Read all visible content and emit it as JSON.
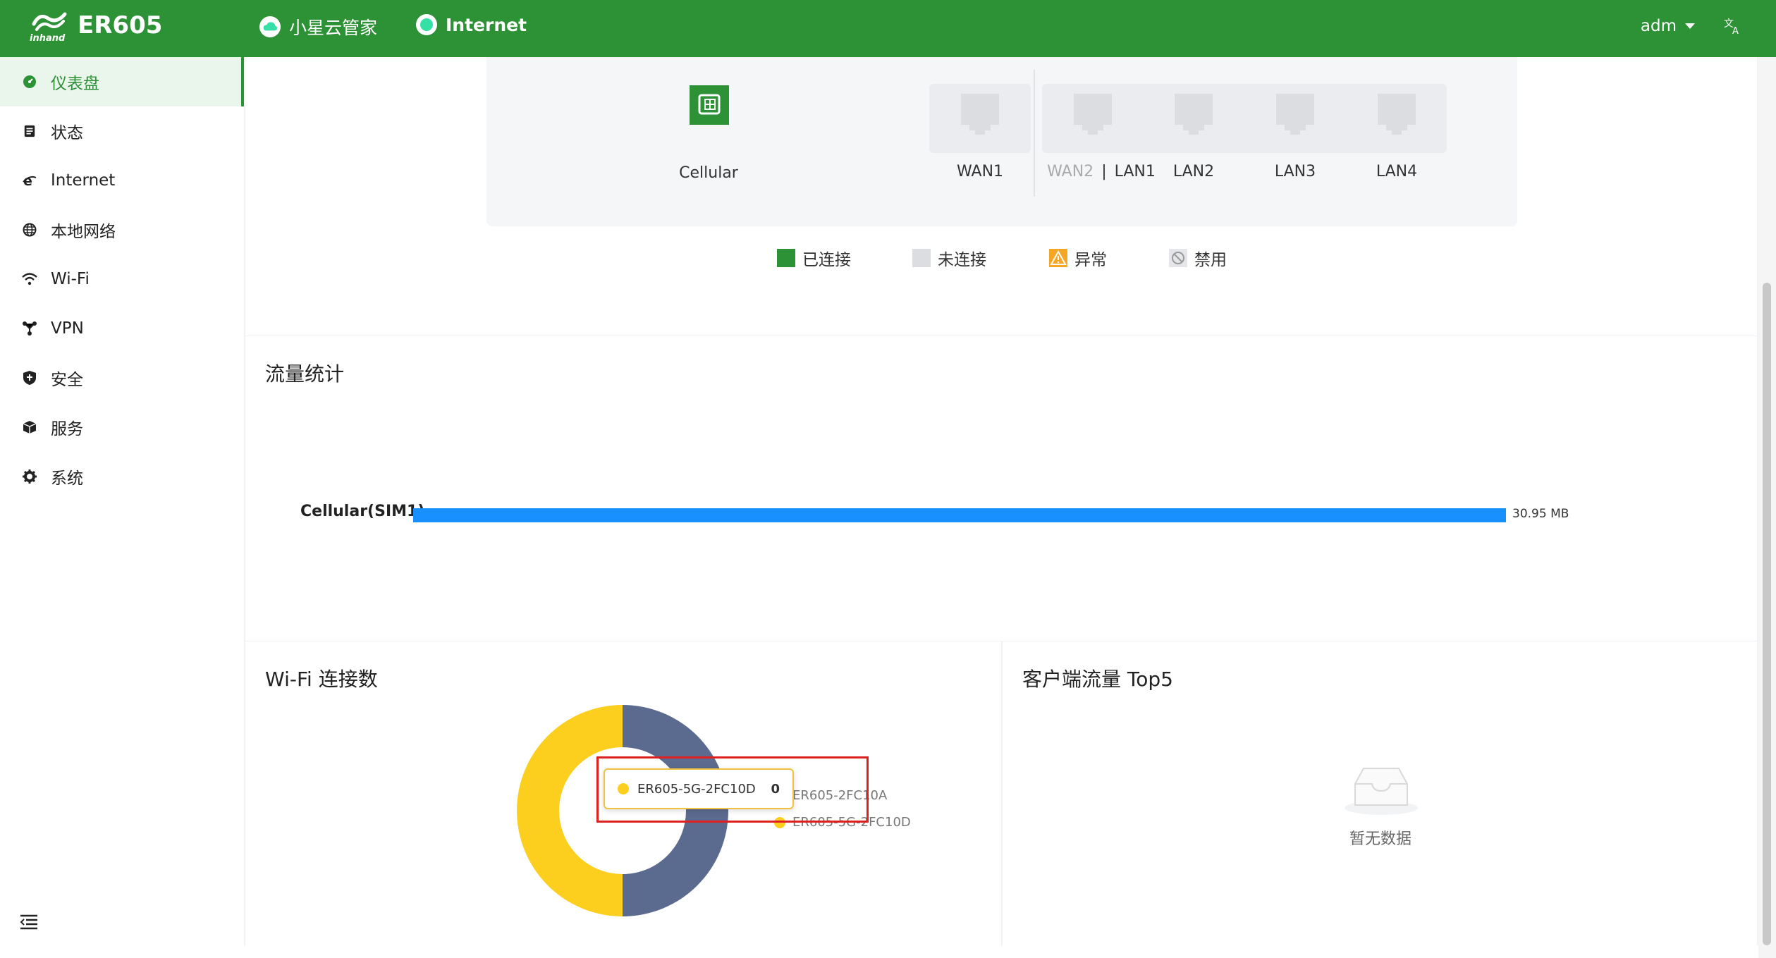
{
  "header": {
    "product": "ER605",
    "cloud_label": "小星云管家",
    "internet_label": "Internet",
    "user": "adm",
    "lang_icon": "文A"
  },
  "sidebar": {
    "items": [
      {
        "label": "仪表盘",
        "icon": "dashboard-icon",
        "active": true
      },
      {
        "label": "状态",
        "icon": "status-icon"
      },
      {
        "label": "Internet",
        "icon": "internet-icon"
      },
      {
        "label": "本地网络",
        "icon": "globe-icon"
      },
      {
        "label": "Wi-Fi",
        "icon": "wifi-icon"
      },
      {
        "label": "VPN",
        "icon": "vpn-icon"
      },
      {
        "label": "安全",
        "icon": "shield-icon"
      },
      {
        "label": "服务",
        "icon": "cube-icon"
      },
      {
        "label": "系统",
        "icon": "gear-icon"
      }
    ]
  },
  "ports": {
    "cellular": "Cellular",
    "wan1": "WAN1",
    "wan2": "WAN2",
    "lan1": "LAN1",
    "lan2": "LAN2",
    "lan3": "LAN3",
    "lan4": "LAN4"
  },
  "legend": {
    "connected": "已连接",
    "disconnected": "未连接",
    "abnormal": "异常",
    "disabled": "禁用",
    "colors": {
      "connected": "#2d9136",
      "disconnected": "#dcdde1",
      "abnormal": "#f5a623",
      "disabled": "#c0c4cc"
    }
  },
  "traffic": {
    "title": "流量统计",
    "bar_label": "Cellular(SIM1)",
    "bar_value": "30.95 MB"
  },
  "wifi": {
    "title": "Wi-Fi 连接数",
    "series": [
      {
        "name": "ER605-2FC10A",
        "color": "#5b6b8f",
        "share": 0.5
      },
      {
        "name": "ER605-5G-2FC10D",
        "color": "#fccf1f",
        "share": 0.5
      }
    ],
    "tooltip_name": "ER605-5G-2FC10D",
    "tooltip_value": "0"
  },
  "top5": {
    "title": "客户端流量 Top5",
    "empty": "暂无数据"
  }
}
